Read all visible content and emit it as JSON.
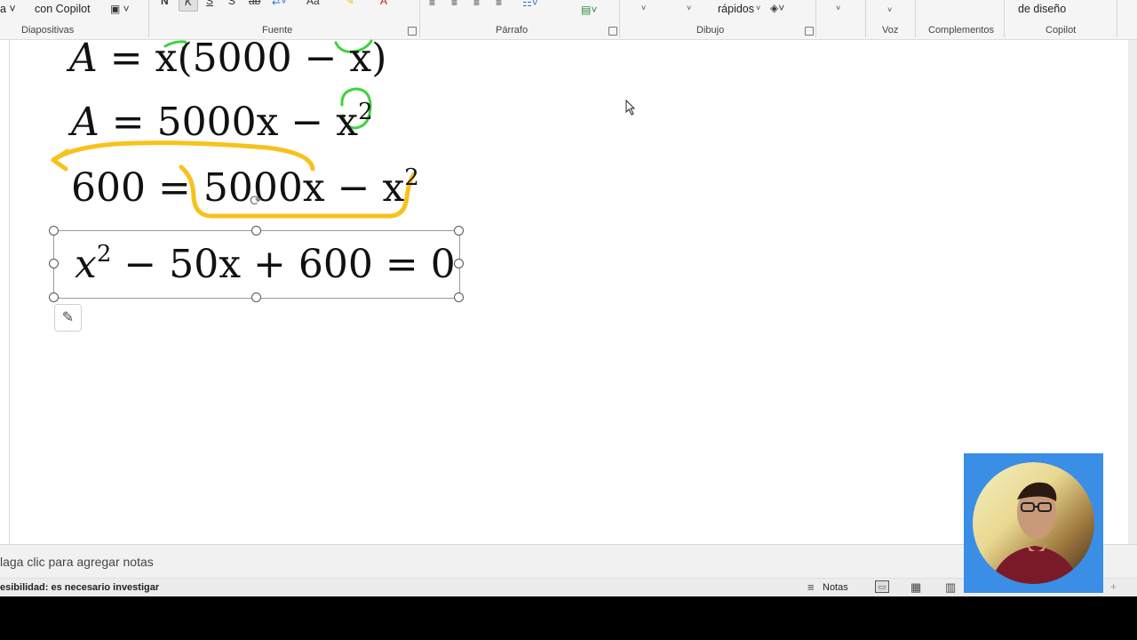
{
  "ribbon": {
    "groups": [
      {
        "label": "Diapositivas"
      },
      {
        "label": "Fuente"
      },
      {
        "label": "Párrafo"
      },
      {
        "label": "Dibujo"
      },
      {
        "label": "Voz"
      },
      {
        "label": "Complementos"
      },
      {
        "label": "Copilot"
      }
    ],
    "copilot_button_label": "con Copilot",
    "quick_styles_label": "rápidos",
    "design_ideas_label": "de diseño",
    "bold_label": "N",
    "italic_label": "K",
    "underline_label": "S",
    "strike_label": "S",
    "case_label": "Aa",
    "font_color_label": "A"
  },
  "slide": {
    "equations": [
      {
        "lhs": "A",
        "text": "= x(5000 − x)"
      },
      {
        "lhs": "A",
        "text": "= 5000x − x",
        "sup": "2"
      },
      {
        "lhs": "600",
        "text": "= 5000x − x",
        "sup": "2"
      },
      {
        "text": "x",
        "sup": "2",
        "rest": "− 50x + 600 = 0"
      }
    ],
    "annotation_colors": {
      "green": "#3fd23f",
      "yellow": "#f7c21c"
    }
  },
  "notes": {
    "placeholder": "laga clic para agregar notas"
  },
  "status": {
    "accessibility": "esibilidad: es necesario investigar",
    "notes_button": "Notas"
  }
}
